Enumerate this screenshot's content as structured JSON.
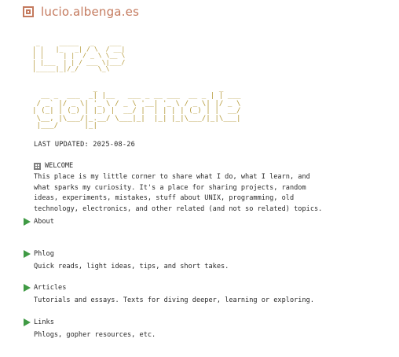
{
  "header": {
    "site_title": "lucio.albenga.es",
    "logo_icon": "square-logo-icon"
  },
  "ascii_art": {
    "block1": " _     _____   _    ___ \n| |   |_   _| / \\  / __|\n| |     | |  / _ \\ \\__ \\\n| |___  | | / ___ \\|___/\n|_____|_|/_/     \\_\\    ",
    "block2": "              _                            _       \n  __ _  ___  _| |__   ___ _ __ ___  __ _ | | ___ \n / _` |/ _ \\| '_ \\ / _ \\ '__| '_ \\ / _ \\| |/ _ \\\n| (_| | (_) | |_) |  __/ |  | | | | (_) | |  __/\n \\__, |\\___/|_.__/ \\___|_|  |_| |_|\\___/|_|\\___|\n |___/      |_|                                  "
  },
  "updated": "LAST UPDATED: 2025-08-26",
  "welcome": {
    "icon": "grid-icon",
    "heading": "WELCOME",
    "lines": [
      "This place is my little corner to share what I do, what I learn, and",
      "what sparks my curiosity. It's a place for sharing projects, random",
      "ideas, experiments, mistakes, stuff about UNIX, programming, old",
      "technology, electronics, and other related (and not so related) topics."
    ]
  },
  "menu": {
    "about": {
      "label": "About"
    },
    "phlog": {
      "label": "Phlog",
      "desc": "Quick reads, light ideas, tips, and short takes."
    },
    "articles": {
      "label": "Articles",
      "desc": "Tutorials and essays. Texts for diving deeper, learning or exploring."
    },
    "links": {
      "label": "Links",
      "desc": "Phlogs, gopher resources, etc."
    }
  },
  "colors": {
    "accent": "#c47a5e",
    "ascii": "#b59a3a",
    "arrow": "#3f9a44",
    "text": "#2a2a2a"
  }
}
